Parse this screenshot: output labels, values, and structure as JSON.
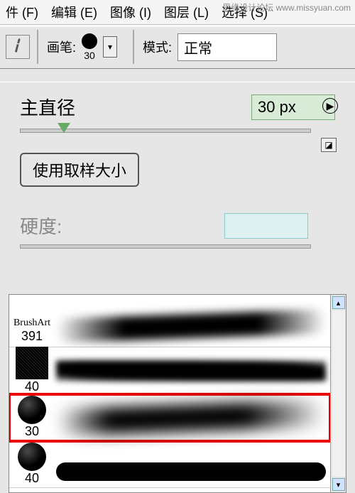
{
  "menu": {
    "file": "件 (F)",
    "edit": "编辑 (E)",
    "image": "图像 (I)",
    "layer": "图层 (L)",
    "select": "选择 (S)"
  },
  "watermark": "思缘设计论坛  www.missyuan.com",
  "options": {
    "brush_label": "画笔:",
    "brush_size_mini": "30",
    "mode_label": "模式:",
    "mode_value": "正常"
  },
  "panel": {
    "diameter_label": "主直径",
    "diameter_value": "30 px",
    "use_sample": "使用取样大小",
    "hardness_label": "硬度:"
  },
  "brush_list": {
    "items": [
      {
        "label": "391"
      },
      {
        "label": "40"
      },
      {
        "label": "30"
      },
      {
        "label": "40"
      }
    ]
  }
}
